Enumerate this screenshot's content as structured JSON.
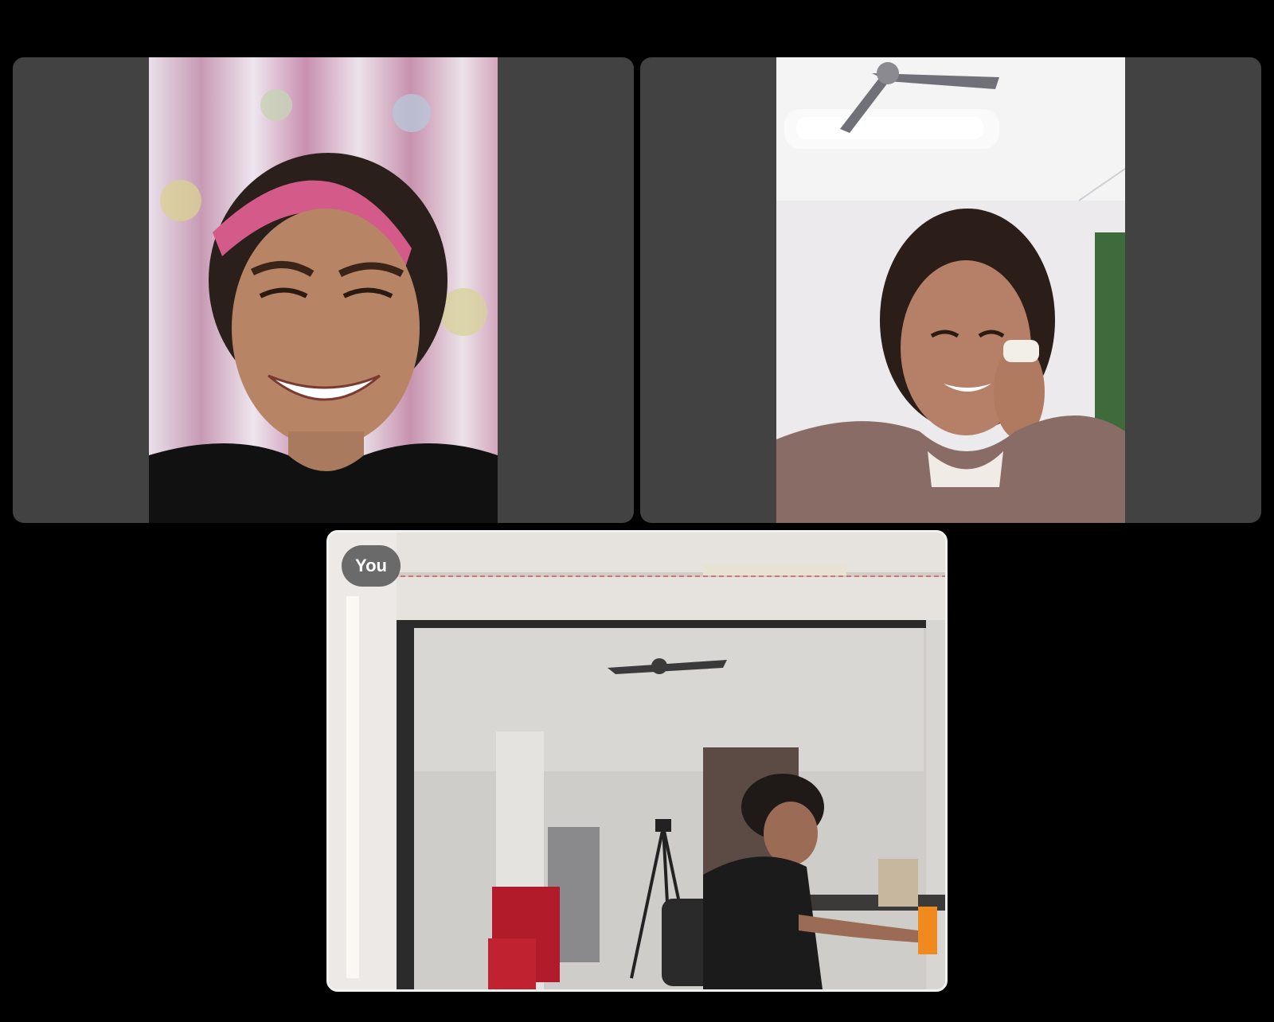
{
  "call": {
    "participants": [
      {
        "id": "participant-1",
        "description_icon": "video-feed"
      },
      {
        "id": "participant-2",
        "description_icon": "video-feed"
      }
    ],
    "self_view": {
      "label": "You"
    }
  },
  "colors": {
    "background": "#000000",
    "tile_background": "#424242",
    "self_border": "#f2f2f2"
  }
}
